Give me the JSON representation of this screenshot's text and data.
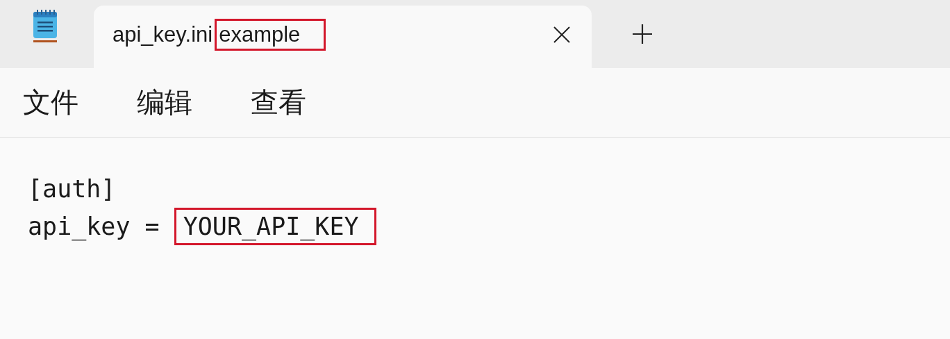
{
  "tabs": [
    {
      "title": [
        {
          "text": "api_key.ini",
          "highlighted": false
        },
        {
          "text": "example",
          "highlighted": true
        }
      ],
      "selected": true
    }
  ],
  "menu": [
    "文件",
    "编辑",
    "查看"
  ],
  "editor": {
    "lines": [
      [
        {
          "text": "[auth]",
          "highlighted": false
        }
      ],
      [
        {
          "text": "api_key = ",
          "highlighted": false
        },
        {
          "text": "YOUR_API_KEY",
          "highlighted": true
        }
      ]
    ]
  }
}
